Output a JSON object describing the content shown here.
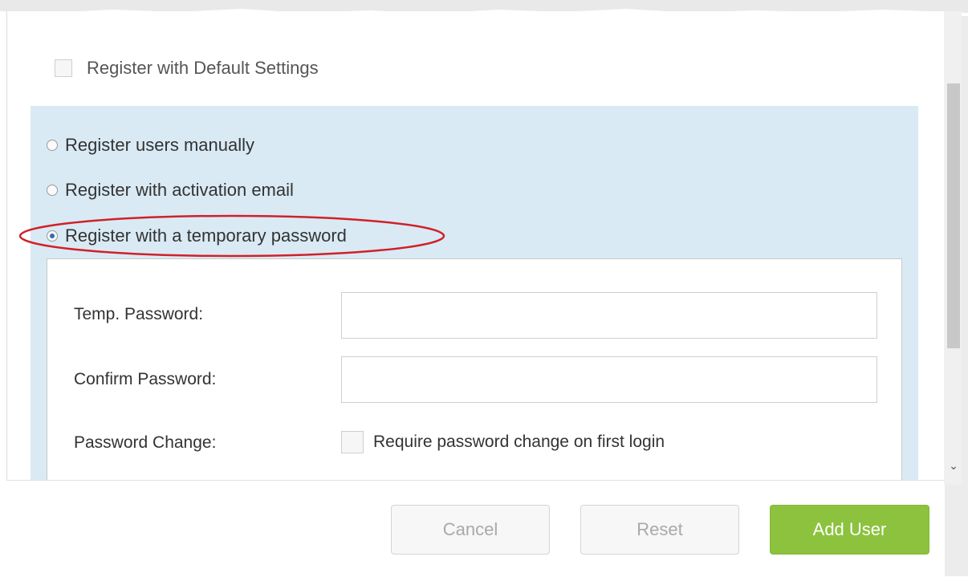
{
  "register_default": {
    "label": "Register with Default Settings",
    "checked": false
  },
  "registration_options": [
    {
      "label": "Register users manually",
      "selected": false
    },
    {
      "label": "Register with activation email",
      "selected": false
    },
    {
      "label": "Register with a temporary password",
      "selected": true
    }
  ],
  "temp_password_form": {
    "temp_password_label": "Temp. Password:",
    "temp_password_value": "",
    "confirm_password_label": "Confirm Password:",
    "confirm_password_value": "",
    "password_change_label": "Password Change:",
    "require_change_label": "Require password change on first login",
    "require_change_checked": false
  },
  "buttons": {
    "cancel": "Cancel",
    "reset": "Reset",
    "add_user": "Add User"
  },
  "colors": {
    "panel_bg": "#d9eaf4",
    "primary_button": "#8cc23e",
    "highlight_oval": "#d0202a",
    "radio_selected": "#2d6db3"
  },
  "icons": {
    "scroll_down": "chevron-down-icon"
  }
}
